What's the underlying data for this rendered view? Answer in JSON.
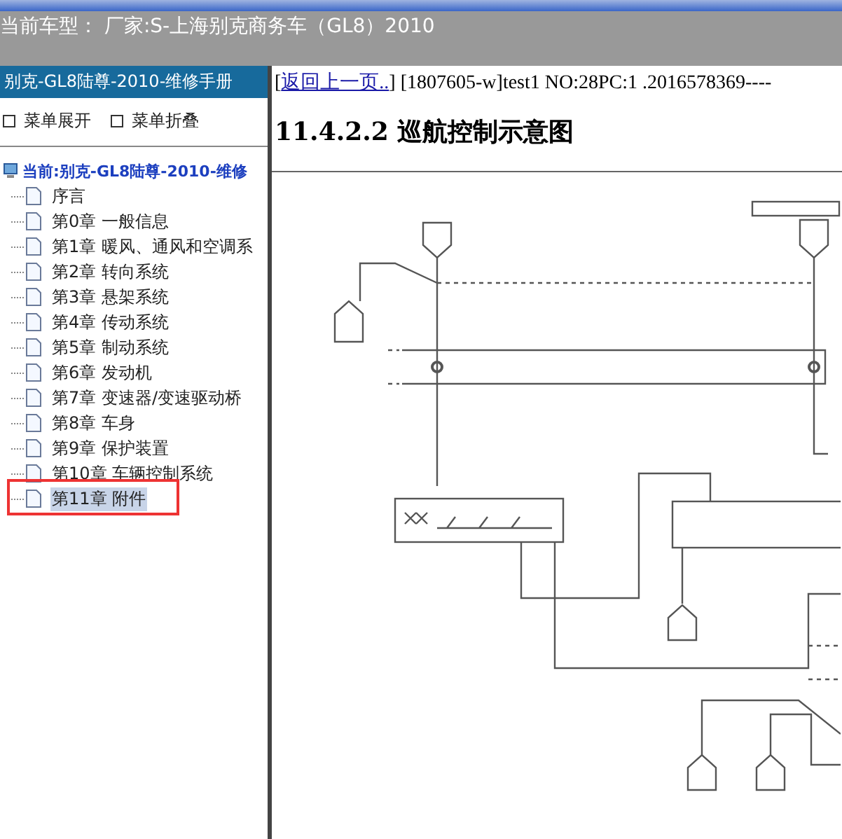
{
  "header": {
    "title": "当前车型： 厂家:S-上海别克商务车（GL8）2010"
  },
  "sidebar": {
    "title": "别克-GL8陆尊-2010-维修手册",
    "actions": [
      {
        "label": "菜单展开"
      },
      {
        "label": "菜单折叠"
      }
    ],
    "tree": {
      "label": "当前:别克-GL8陆尊-2010-维修",
      "children": [
        {
          "label": "序言",
          "selected": false,
          "marked": false
        },
        {
          "label": "第0章 一般信息",
          "selected": false,
          "marked": false
        },
        {
          "label": "第1章 暖风、通风和空调系",
          "selected": false,
          "marked": false
        },
        {
          "label": "第2章 转向系统",
          "selected": false,
          "marked": false
        },
        {
          "label": "第3章 悬架系统",
          "selected": false,
          "marked": false
        },
        {
          "label": "第4章 传动系统",
          "selected": false,
          "marked": false
        },
        {
          "label": "第5章 制动系统",
          "selected": false,
          "marked": false
        },
        {
          "label": "第6章 发动机",
          "selected": false,
          "marked": false
        },
        {
          "label": "第7章 变速器/变速驱动桥",
          "selected": false,
          "marked": false
        },
        {
          "label": "第8章 车身",
          "selected": false,
          "marked": false
        },
        {
          "label": "第9章 保护装置",
          "selected": false,
          "marked": false
        },
        {
          "label": "第10章 车辆控制系统",
          "selected": false,
          "marked": false
        },
        {
          "label": "第11章 附件",
          "selected": true,
          "marked": true
        }
      ]
    }
  },
  "content": {
    "back_link": {
      "open": "[",
      "label": "返回上一页..",
      "close": "]"
    },
    "info": "[1807605-w]test1 NO:28PC:1 .2016578369----",
    "heading": "11.4.2.2 巡航控制示意图"
  }
}
